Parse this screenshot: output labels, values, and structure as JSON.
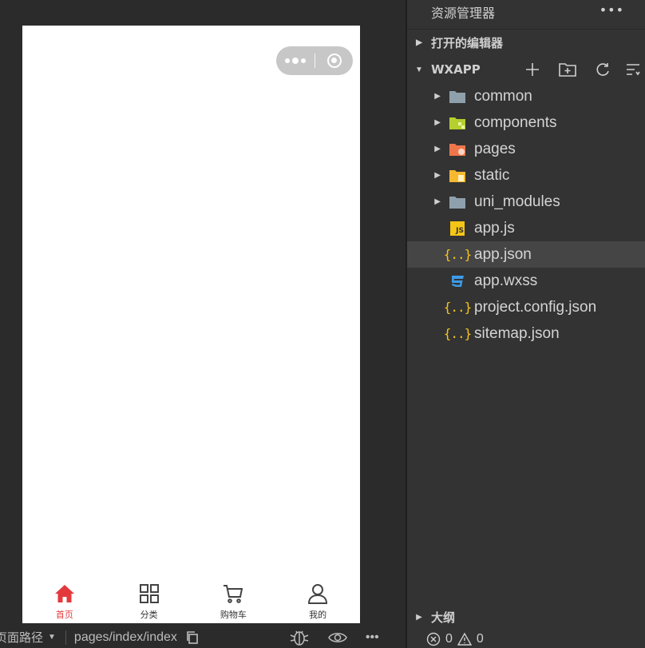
{
  "simulator": {
    "tabbar": [
      {
        "label": "首页",
        "icon": "home-icon",
        "active": true
      },
      {
        "label": "分类",
        "icon": "grid-icon",
        "active": false
      },
      {
        "label": "购物车",
        "icon": "cart-icon",
        "active": false
      },
      {
        "label": "我的",
        "icon": "user-icon",
        "active": false
      }
    ],
    "status": {
      "path_label": "页面路径",
      "path_value": "pages/index/index"
    }
  },
  "explorer": {
    "title": "资源管理器",
    "open_editors_label": "打开的编辑器",
    "project_label": "WXAPP",
    "outline_label": "大纲",
    "files": [
      {
        "name": "common",
        "type": "folder",
        "icon": "folder-icon"
      },
      {
        "name": "components",
        "type": "folder",
        "icon": "folder-components-icon"
      },
      {
        "name": "pages",
        "type": "folder",
        "icon": "folder-pages-icon"
      },
      {
        "name": "static",
        "type": "folder",
        "icon": "folder-static-icon"
      },
      {
        "name": "uni_modules",
        "type": "folder",
        "icon": "folder-icon"
      },
      {
        "name": "app.js",
        "type": "file",
        "icon": "js-file-icon"
      },
      {
        "name": "app.json",
        "type": "file",
        "icon": "json-file-icon",
        "selected": true
      },
      {
        "name": "app.wxss",
        "type": "file",
        "icon": "css-file-icon"
      },
      {
        "name": "project.config.json",
        "type": "file",
        "icon": "json-file-icon"
      },
      {
        "name": "sitemap.json",
        "type": "file",
        "icon": "json-file-icon"
      }
    ],
    "problems": {
      "errors": "0",
      "warnings": "0"
    }
  },
  "colors": {
    "accent_red": "#e4393c",
    "json_yellow": "#f5c518",
    "css_blue": "#3d9be9",
    "folder_grey": "#8fa0ad",
    "components_green": "#b4cf2e",
    "pages_orange": "#f0764a",
    "static_yellow": "#f5b82e"
  }
}
